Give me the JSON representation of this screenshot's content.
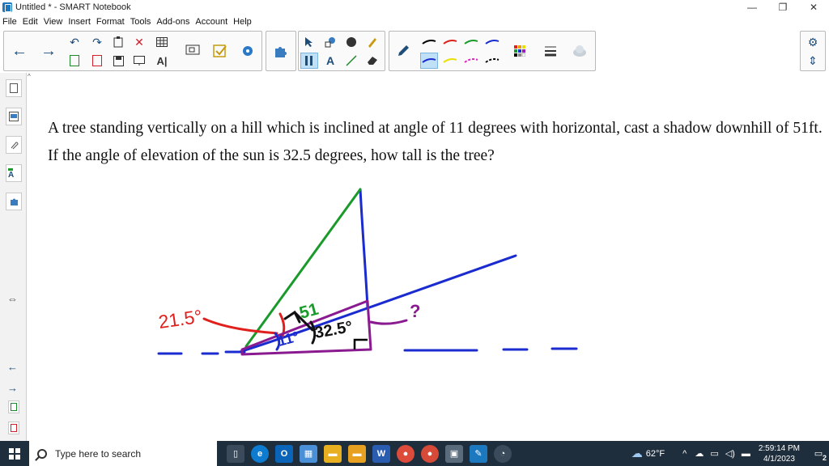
{
  "window": {
    "title": "Untitled * - SMART Notebook",
    "minimize": "—",
    "restore": "❐",
    "close": "✕"
  },
  "menu": [
    "File",
    "Edit",
    "View",
    "Insert",
    "Format",
    "Tools",
    "Add-ons",
    "Account",
    "Help"
  ],
  "toolbar": {
    "back_icon": "←",
    "forward_icon": "→",
    "undo_icon": "↶",
    "redo_icon": "↷",
    "delete_icon": "✕",
    "text_tool_label": "A",
    "pen_colors": [
      "#000000",
      "#e0201c",
      "#1a9a2a",
      "#1a2bd0",
      "#1a2bd0",
      "#e8e000",
      "#e020c0",
      "#000000"
    ],
    "settings_icon": "⚙",
    "move_icon": "⇕"
  },
  "problem_text": "A tree standing vertically on a hill which is inclined at angle of 11 degrees with horizontal, cast a shadow downhill of 51ft. If the angle of elevation of the sun is 32.5 degrees, how tall is the tree?",
  "annotations": {
    "angle_red": "21.5°",
    "side_green": "51",
    "angle_black": "32.5°",
    "angle_blue": "11°",
    "unknown_purple": "?"
  },
  "taskbar": {
    "search_placeholder": "Type here to search",
    "weather": "62°F",
    "time": "2:59:14 PM",
    "date": "4/1/2023",
    "notifications": "2"
  }
}
